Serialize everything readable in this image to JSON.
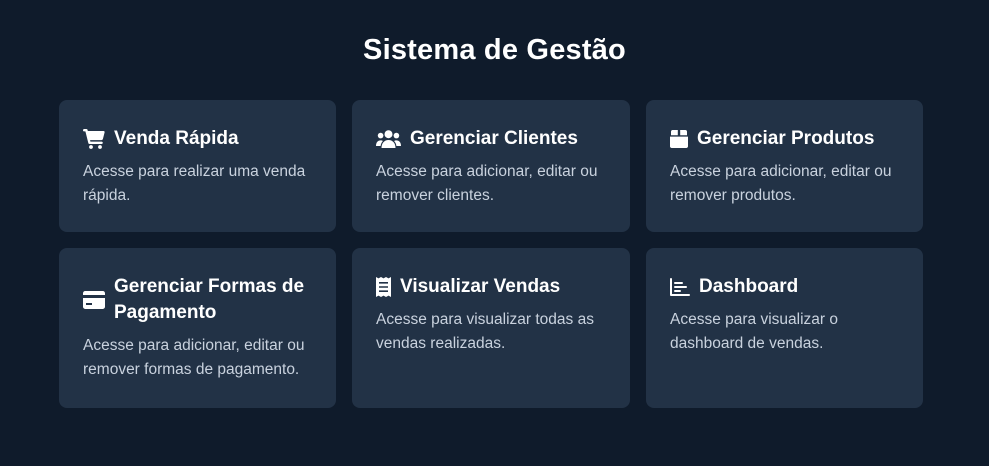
{
  "page": {
    "title": "Sistema de Gestão"
  },
  "cards": [
    {
      "icon": "shopping-cart-icon",
      "title": "Venda Rápida",
      "description": "Acesse para realizar uma venda rápida."
    },
    {
      "icon": "users-icon",
      "title": "Gerenciar Clientes",
      "description": "Acesse para adicionar, editar ou remover clientes."
    },
    {
      "icon": "box-icon",
      "title": "Gerenciar Produtos",
      "description": "Acesse para adicionar, editar ou remover produtos."
    },
    {
      "icon": "credit-card-icon",
      "title": "Gerenciar Formas de Pagamento",
      "description": "Acesse para adicionar, editar ou remover formas de pagamento."
    },
    {
      "icon": "receipt-icon",
      "title": "Visualizar Vendas",
      "description": "Acesse para visualizar todas as vendas realizadas."
    },
    {
      "icon": "chart-icon",
      "title": "Dashboard",
      "description": "Acesse para visualizar o dashboard de vendas."
    }
  ],
  "colors": {
    "background": "#0f1b2b",
    "card": "#223246",
    "text": "#ffffff",
    "muted_text": "#c9d2de"
  }
}
